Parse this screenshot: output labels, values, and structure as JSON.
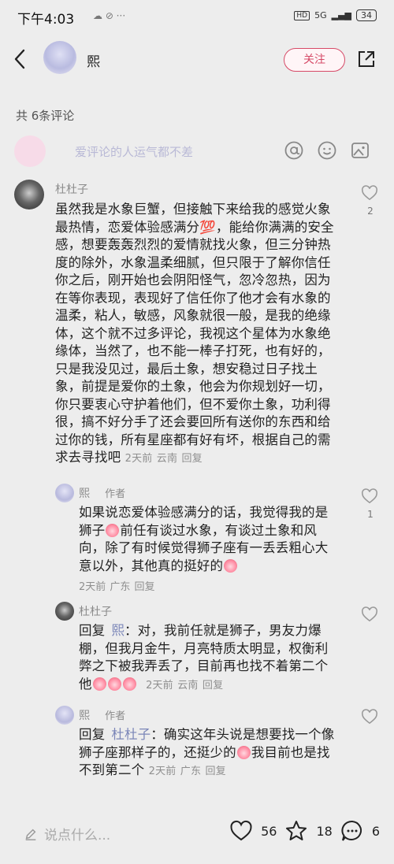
{
  "status_bar": {
    "time": "下午4:03",
    "signal": "5G",
    "battery": "34"
  },
  "header": {
    "username": "熙",
    "follow_label": "关注"
  },
  "comment_count": "共 6条评论",
  "input": {
    "placeholder": "爱评论的人运气都不差"
  },
  "comments": [
    {
      "name": "杜杜子",
      "lines": [
        "虽然我是水象巨蟹，但接触下来给我的感觉火象",
        "最热情，恋爱体验感满分💯，能给你满满的安全",
        "感，想要轰轰烈烈的爱情就找火象，但三分钟热",
        "度的除外，水象温柔细腻，但只限于了解你信任",
        "你之后，刚开始也会阴阳怪气，忽冷忽热，因为",
        "在等你表现，表现好了信任你了他才会有水象的",
        "温柔，粘人，敏感，风象就很一般，是我的绝缘",
        "体，这个就不过多评论，我视这个星体为水象绝",
        "缘体，当然了，也不能一棒子打死，也有好的，",
        "只是我没见过，最后土象，想安稳过日子找土",
        "象，前提是爱你的土象，他会为你规划好一切，",
        "你只要衷心守护着他们，但不爱你土象，功利得",
        "很，搞不好分手了还会要回所有送你的东西和给",
        "过你的钱，所有星座都有好有坏，根据自己的需"
      ],
      "last_line": "求去寻找吧",
      "meta_time": "2天前",
      "meta_place": "云南",
      "reply_label": "回复",
      "likes": "2"
    },
    {
      "name": "熙",
      "author_tag": "作者",
      "lines": [
        "如果说恋爱体验感满分的话，我觉得我的是",
        "狮子",
        "前任有谈过水象，有谈过土象和风",
        "向，除了有时候觉得狮子座有一丢丢粗心大",
        "意以外，其他真的挺好的"
      ],
      "meta_time": "2天前",
      "meta_place": "广东",
      "reply_label": "回复",
      "likes": "1"
    },
    {
      "name": "杜杜子",
      "reply_prefix": "回复",
      "reply_to": "熙",
      "lines": [
        "：对，我前任就是狮子，男友力爆",
        "棚，但我月金牛，月亮特质太明显，权衡利",
        "弊之下被我弄丢了，目前再也找不着第二个",
        "他"
      ],
      "meta_time": "2天前",
      "meta_place": "云南",
      "reply_label": "回复"
    },
    {
      "name": "熙",
      "author_tag": "作者",
      "reply_prefix": "回复",
      "reply_to": "杜杜子",
      "lines": [
        "：确实这年头说是想要找一个像",
        "狮子座那样子的，还挺少的",
        "我目前也是找",
        "不到第二个"
      ],
      "meta_time": "2天前",
      "meta_place": "广东",
      "reply_label": "回复"
    }
  ],
  "bottom": {
    "say_placeholder": "说点什么...",
    "likes": "56",
    "stars": "18",
    "comments": "6"
  },
  "colors": {
    "accent": "#d64a67",
    "mention": "#7b86b8",
    "background": "#ededed"
  }
}
